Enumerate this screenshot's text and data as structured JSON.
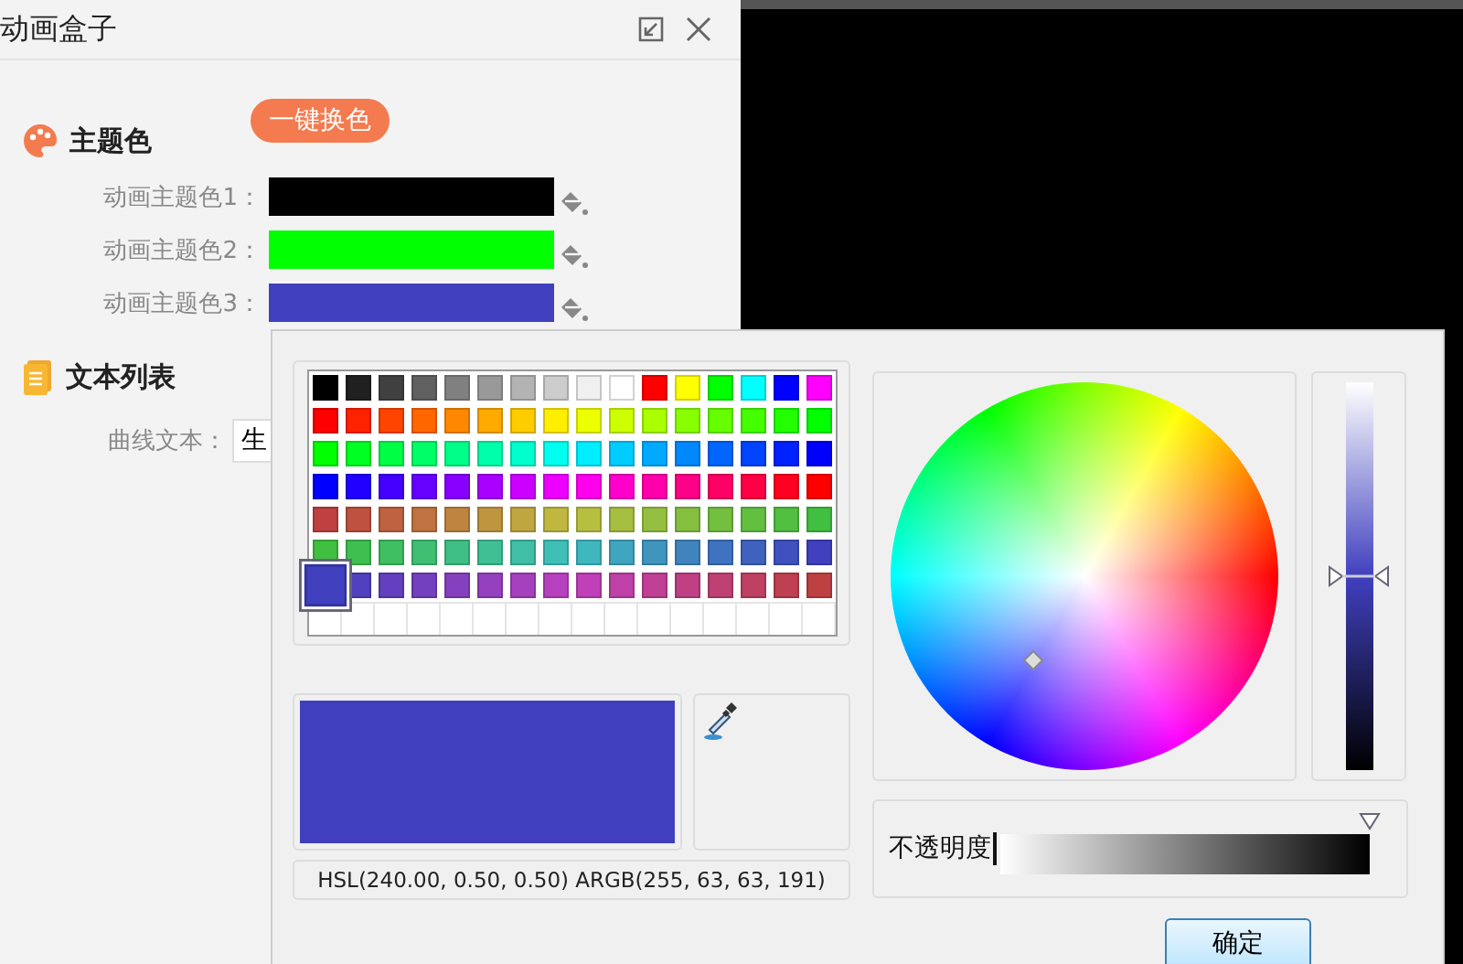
{
  "panel": {
    "title": "动画盒子"
  },
  "theme_section": {
    "title": "主题色",
    "button": "一键换色",
    "colors": [
      {
        "label": "动画主题色1：",
        "color": "#000000"
      },
      {
        "label": "动画主题色2：",
        "color": "#00ff00"
      },
      {
        "label": "动画主题色3：",
        "color": "#4040bf"
      }
    ]
  },
  "text_section": {
    "title": "文本列表",
    "field_label": "曲线文本：",
    "value": "生"
  },
  "color_dialog": {
    "palette": [
      [
        {
          "color": "#000000",
          "selected": false
        },
        {
          "color": "#202020",
          "selected": false
        },
        {
          "color": "#404040",
          "selected": false
        },
        {
          "color": "#606060",
          "selected": false
        },
        {
          "color": "#808080",
          "selected": false
        },
        {
          "color": "#999999",
          "selected": false
        },
        {
          "color": "#b3b3b3",
          "selected": false
        },
        {
          "color": "#cccccc",
          "selected": false
        },
        {
          "color": "#f0f0f0",
          "selected": false
        },
        {
          "color": "#ffffff",
          "selected": false
        },
        {
          "color": "#ff0000",
          "selected": false
        },
        {
          "color": "#ffff00",
          "selected": false
        },
        {
          "color": "#00ff00",
          "selected": false
        },
        {
          "color": "#00ffff",
          "selected": false
        },
        {
          "color": "#0000ff",
          "selected": false
        },
        {
          "color": "#ff00ff",
          "selected": false
        }
      ],
      [
        {
          "color": "#ff0000",
          "selected": false
        },
        {
          "color": "#ff2200",
          "selected": false
        },
        {
          "color": "#ff4400",
          "selected": false
        },
        {
          "color": "#ff6600",
          "selected": false
        },
        {
          "color": "#ff8800",
          "selected": false
        },
        {
          "color": "#ffaa00",
          "selected": false
        },
        {
          "color": "#ffcc00",
          "selected": false
        },
        {
          "color": "#ffee00",
          "selected": false
        },
        {
          "color": "#eeff00",
          "selected": false
        },
        {
          "color": "#ccff00",
          "selected": false
        },
        {
          "color": "#aaff00",
          "selected": false
        },
        {
          "color": "#88ff00",
          "selected": false
        },
        {
          "color": "#66ff00",
          "selected": false
        },
        {
          "color": "#44ff00",
          "selected": false
        },
        {
          "color": "#22ff00",
          "selected": false
        },
        {
          "color": "#00ff00",
          "selected": false
        }
      ],
      [
        {
          "color": "#00ff00",
          "selected": false
        },
        {
          "color": "#00ff22",
          "selected": false
        },
        {
          "color": "#00ff44",
          "selected": false
        },
        {
          "color": "#00ff66",
          "selected": false
        },
        {
          "color": "#00ff88",
          "selected": false
        },
        {
          "color": "#00ffaa",
          "selected": false
        },
        {
          "color": "#00ffcc",
          "selected": false
        },
        {
          "color": "#00ffee",
          "selected": false
        },
        {
          "color": "#00eeff",
          "selected": false
        },
        {
          "color": "#00ccff",
          "selected": false
        },
        {
          "color": "#00aaff",
          "selected": false
        },
        {
          "color": "#0088ff",
          "selected": false
        },
        {
          "color": "#0066ff",
          "selected": false
        },
        {
          "color": "#0044ff",
          "selected": false
        },
        {
          "color": "#0022ff",
          "selected": false
        },
        {
          "color": "#0000ff",
          "selected": false
        }
      ],
      [
        {
          "color": "#0000ff",
          "selected": false
        },
        {
          "color": "#2200ff",
          "selected": false
        },
        {
          "color": "#4400ff",
          "selected": false
        },
        {
          "color": "#6600ff",
          "selected": false
        },
        {
          "color": "#8800ff",
          "selected": false
        },
        {
          "color": "#aa00ff",
          "selected": false
        },
        {
          "color": "#cc00ff",
          "selected": false
        },
        {
          "color": "#ee00ff",
          "selected": false
        },
        {
          "color": "#ff00ee",
          "selected": false
        },
        {
          "color": "#ff00cc",
          "selected": false
        },
        {
          "color": "#ff00aa",
          "selected": false
        },
        {
          "color": "#ff0088",
          "selected": false
        },
        {
          "color": "#ff0066",
          "selected": false
        },
        {
          "color": "#ff0044",
          "selected": false
        },
        {
          "color": "#ff0022",
          "selected": false
        },
        {
          "color": "#ff0000",
          "selected": false
        }
      ],
      [
        {
          "color": "#bf4040",
          "selected": false
        },
        {
          "color": "#bf5140",
          "selected": false
        },
        {
          "color": "#bf6240",
          "selected": false
        },
        {
          "color": "#bf7340",
          "selected": false
        },
        {
          "color": "#bf8440",
          "selected": false
        },
        {
          "color": "#bf9540",
          "selected": false
        },
        {
          "color": "#bfa640",
          "selected": false
        },
        {
          "color": "#bfb740",
          "selected": false
        },
        {
          "color": "#b7bf40",
          "selected": false
        },
        {
          "color": "#a6bf40",
          "selected": false
        },
        {
          "color": "#95bf40",
          "selected": false
        },
        {
          "color": "#84bf40",
          "selected": false
        },
        {
          "color": "#73bf40",
          "selected": false
        },
        {
          "color": "#62bf40",
          "selected": false
        },
        {
          "color": "#51bf40",
          "selected": false
        },
        {
          "color": "#40bf40",
          "selected": false
        }
      ],
      [
        {
          "color": "#40bf40",
          "selected": false
        },
        {
          "color": "#40bf51",
          "selected": false
        },
        {
          "color": "#40bf62",
          "selected": false
        },
        {
          "color": "#40bf73",
          "selected": false
        },
        {
          "color": "#40bf84",
          "selected": false
        },
        {
          "color": "#40bf95",
          "selected": false
        },
        {
          "color": "#40bfa6",
          "selected": false
        },
        {
          "color": "#40bfb7",
          "selected": false
        },
        {
          "color": "#40b7bf",
          "selected": false
        },
        {
          "color": "#40a6bf",
          "selected": false
        },
        {
          "color": "#4095bf",
          "selected": false
        },
        {
          "color": "#4084bf",
          "selected": false
        },
        {
          "color": "#4073bf",
          "selected": false
        },
        {
          "color": "#4062bf",
          "selected": false
        },
        {
          "color": "#4051bf",
          "selected": false
        },
        {
          "color": "#4040bf",
          "selected": false
        }
      ],
      [
        {
          "color": "#4040bf",
          "selected": true
        },
        {
          "color": "#5140bf",
          "selected": false
        },
        {
          "color": "#6240bf",
          "selected": false
        },
        {
          "color": "#7340bf",
          "selected": false
        },
        {
          "color": "#8440bf",
          "selected": false
        },
        {
          "color": "#9540bf",
          "selected": false
        },
        {
          "color": "#a640bf",
          "selected": false
        },
        {
          "color": "#b740bf",
          "selected": false
        },
        {
          "color": "#bf40b7",
          "selected": false
        },
        {
          "color": "#bf40a6",
          "selected": false
        },
        {
          "color": "#bf4095",
          "selected": false
        },
        {
          "color": "#bf4084",
          "selected": false
        },
        {
          "color": "#bf4073",
          "selected": false
        },
        {
          "color": "#bf4062",
          "selected": false
        },
        {
          "color": "#bf4051",
          "selected": false
        },
        {
          "color": "#bf4040",
          "selected": false
        }
      ]
    ],
    "preview": {
      "color": "#4040bf"
    },
    "readout": "HSL(240.00, 0.50, 0.50)  ARGB(255, 63, 63, 191)",
    "lightness": {
      "level": 0.5
    },
    "opacity": {
      "label": "不透明度",
      "level": 1
    },
    "ok_button": "确定"
  }
}
